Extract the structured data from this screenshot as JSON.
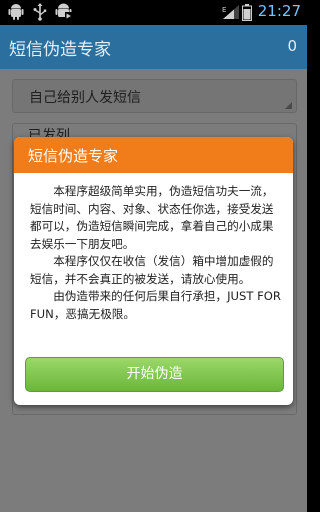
{
  "status_bar": {
    "time": "21:27",
    "icons": [
      "android-icon",
      "usb-icon",
      "android-debug-icon",
      "signal-icon",
      "battery-icon"
    ]
  },
  "app_bar": {
    "title": "短信伪造专家",
    "count": "0"
  },
  "main": {
    "spinner_value": "自己给别人发短信",
    "partial_label": "已发列"
  },
  "dialog": {
    "title": "短信伪造专家",
    "paragraphs": [
      "本程序超级简单实用，伪造短信功夫一流，短信时间、内容、对象、状态任你选，接受发送都可以，伪造短信瞬间完成，拿着自己的小成果去娱乐一下朋友吧。",
      "本程序仅仅在收信（发信）箱中增加虚假的短信，并不会真正的被发送，请放心使用。",
      "由伪造带来的任何后果自行承担，JUST FOR FUN，恶搞无极限。"
    ],
    "button_label": "开始伪造"
  },
  "colors": {
    "appbar": "#2a6f9d",
    "dialog_header": "#f07c1a",
    "button": "#7cc24a",
    "clock": "#6fc9ff"
  }
}
